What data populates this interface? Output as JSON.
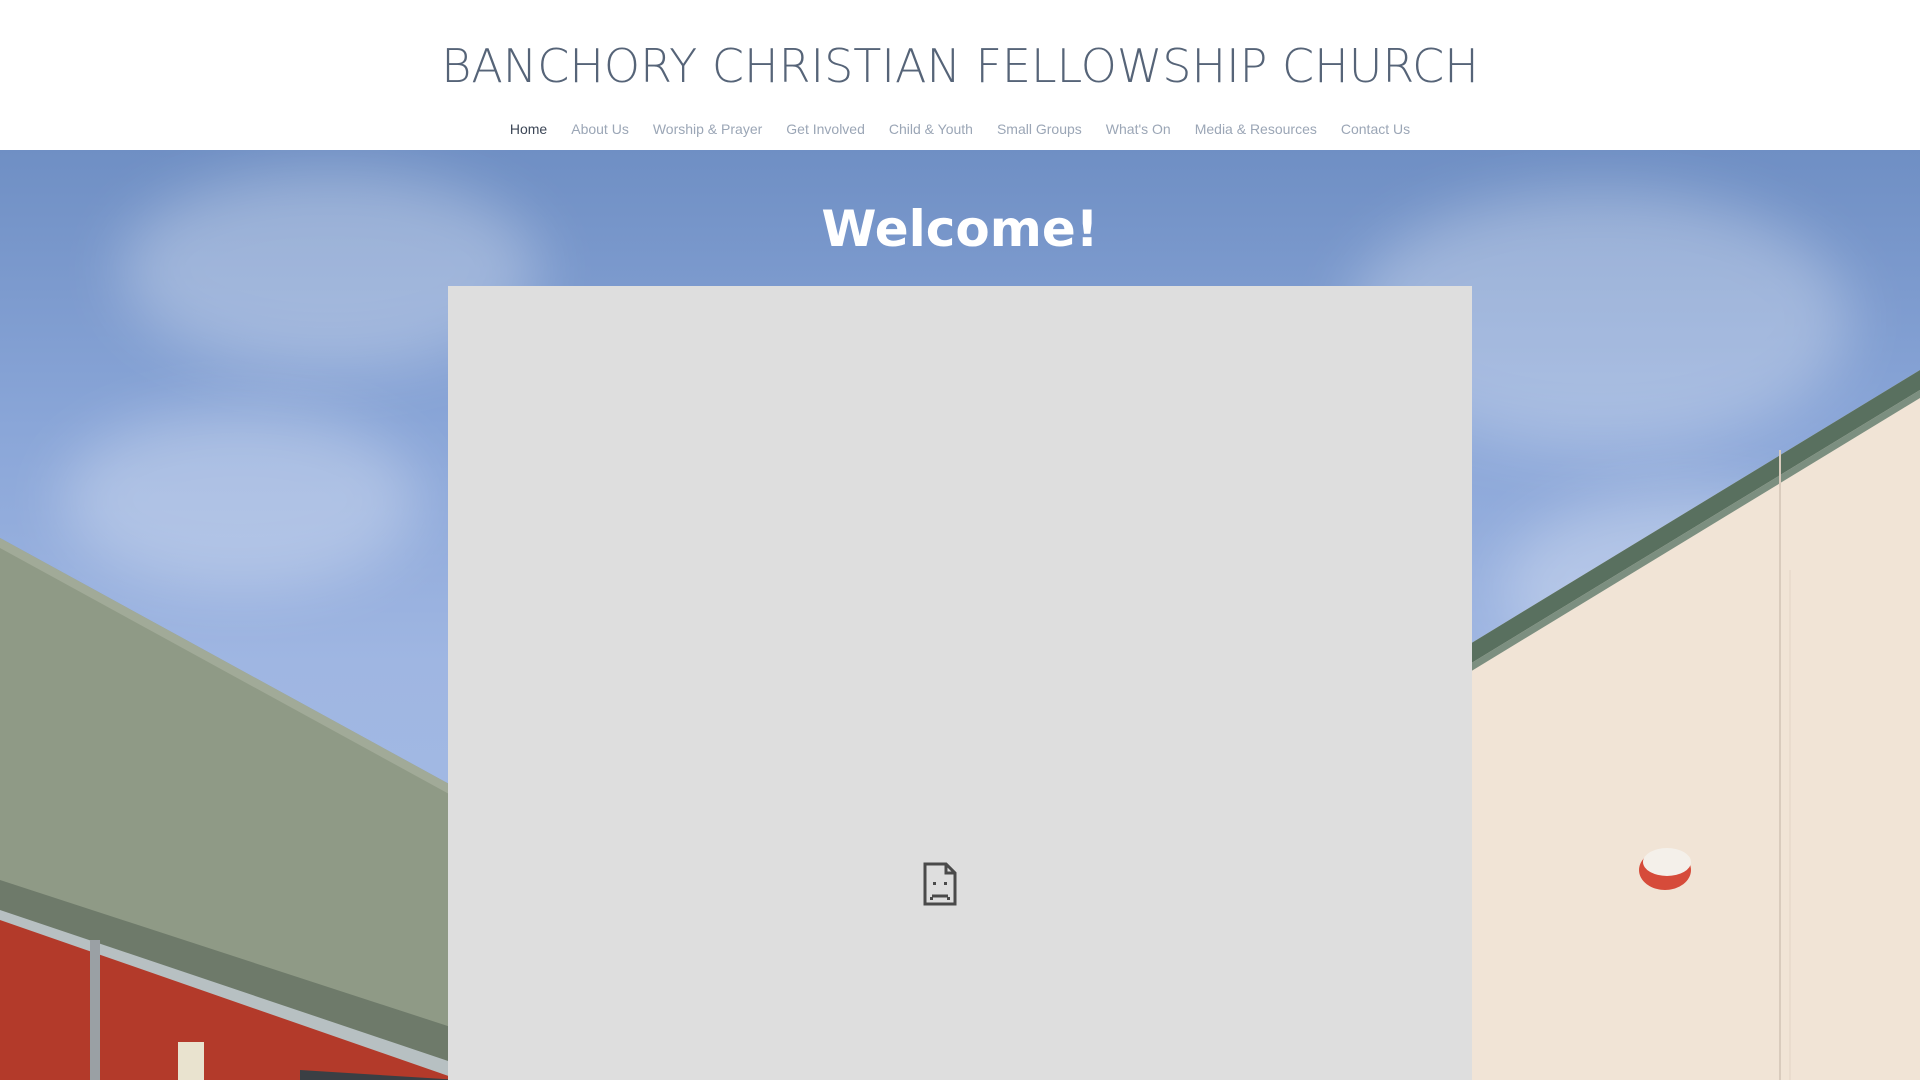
{
  "site": {
    "title": "BANCHORY CHRISTIAN FELLOWSHIP CHURCH"
  },
  "nav": {
    "items": [
      {
        "label": "Home",
        "active": true
      },
      {
        "label": "About Us",
        "active": false
      },
      {
        "label": "Worship & Prayer",
        "active": false
      },
      {
        "label": "Get Involved",
        "active": false
      },
      {
        "label": "Child & Youth",
        "active": false
      },
      {
        "label": "Small Groups",
        "active": false
      },
      {
        "label": "What's On",
        "active": false
      },
      {
        "label": "Media & Resources",
        "active": false
      },
      {
        "label": "Contact Us",
        "active": false
      }
    ]
  },
  "hero": {
    "heading": "Welcome!",
    "embed_state": "broken-file-icon"
  },
  "colors": {
    "title": "#566478",
    "nav_inactive": "#9ba6b6",
    "nav_active": "#3c4656",
    "embed_bg": "#dedede",
    "sky": "#8aa6d8"
  }
}
